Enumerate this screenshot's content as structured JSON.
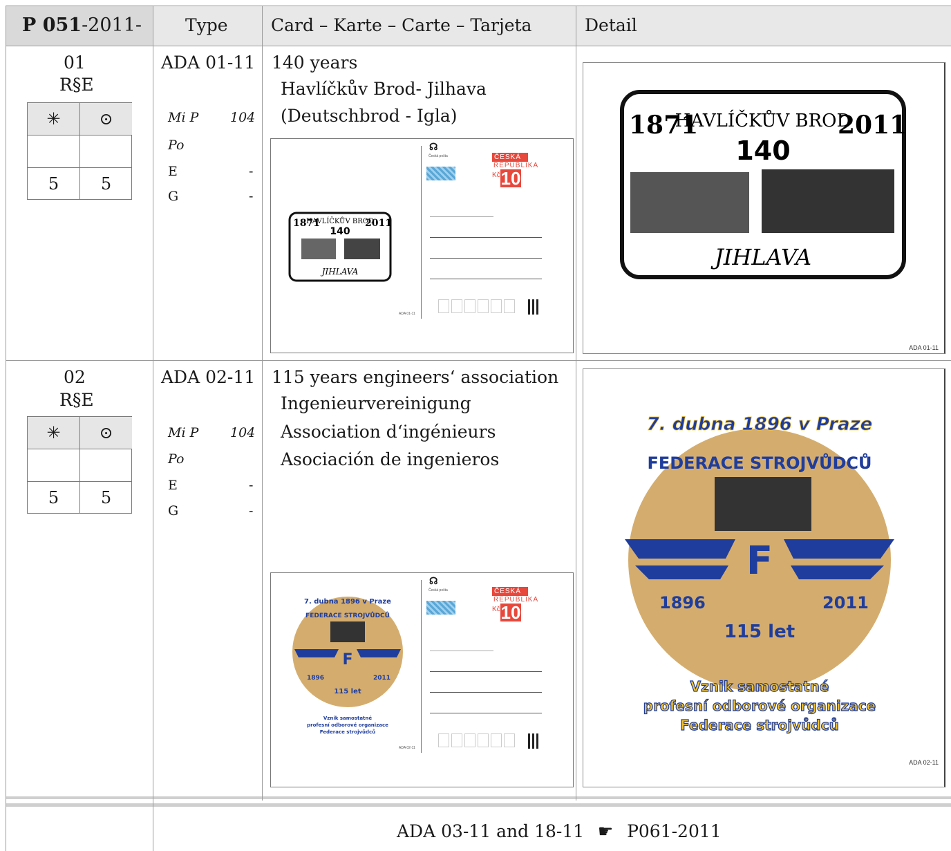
{
  "header": {
    "catalog_bold": "P 051",
    "catalog_rest": "-2011-",
    "type": "Type",
    "card": "Card – Karte – Carte – Tarjeta",
    "detail": "Detail"
  },
  "rows": [
    {
      "num": "01",
      "rse": "R§E",
      "status": {
        "mint": "✳",
        "used": "⊙",
        "mint_value": "5",
        "used_value": "5"
      },
      "type_code": "ADA 01-11",
      "mi": "Mi  P",
      "mi_num": "104",
      "po": "Po",
      "e": "E",
      "e_val": "-",
      "g": "G",
      "g_val": "-",
      "desc": [
        "140 years",
        "Havlíčkův Brod- Jilhava",
        "(Deutschbrod - Igla)"
      ],
      "card_code": "ADA 01-11",
      "stamp": {
        "country1": "ČESKÁ",
        "country2": "REPUBLIKA",
        "currency": "Kč",
        "value": "10",
        "post": "Česká pošta"
      },
      "design": {
        "year_left": "1871",
        "year_right": "2011",
        "top": "HAVLÍČKŮV BROD",
        "num": "140",
        "bottom": "JIHLAVA"
      }
    },
    {
      "num": "02",
      "rse": "R§E",
      "status": {
        "mint": "✳",
        "used": "⊙",
        "mint_value": "5",
        "used_value": "5"
      },
      "type_code": "ADA 02-11",
      "mi": "Mi  P",
      "mi_num": "104",
      "po": "Po",
      "e": "E",
      "e_val": "-",
      "g": "G",
      "g_val": "-",
      "desc": [
        "115 years engineers‘ association",
        "Ingenieurvereinigung",
        "Association d‘ingénieurs",
        "Asociación de ingenieros"
      ],
      "card_code": "ADA 02-11",
      "stamp": {
        "country1": "ČESKÁ",
        "country2": "REPUBLIKA",
        "currency": "Kč",
        "value": "10",
        "post": "Česká pošta"
      },
      "design": {
        "arc_top": "7. dubna 1896 v Praze",
        "arc_mid": "FEDERACE STROJVŮDCŮ",
        "year_left": "1896",
        "year_right": "2011",
        "letter": "F",
        "years": "115 let",
        "line1": "Vznik samostatné",
        "line2": "profesní odborové organizace",
        "line3": "Federace strojvůdců"
      }
    }
  ],
  "footer": {
    "text": "ADA 03-11 and 18-11",
    "pointer": "pointing-hand-icon",
    "ref": "P061-2011"
  },
  "colors": {
    "stamp_red": "#e8473b",
    "badge_gold": "#d4ad6e",
    "badge_blue": "#1f3d9c",
    "badge_text": "#f2c230"
  }
}
